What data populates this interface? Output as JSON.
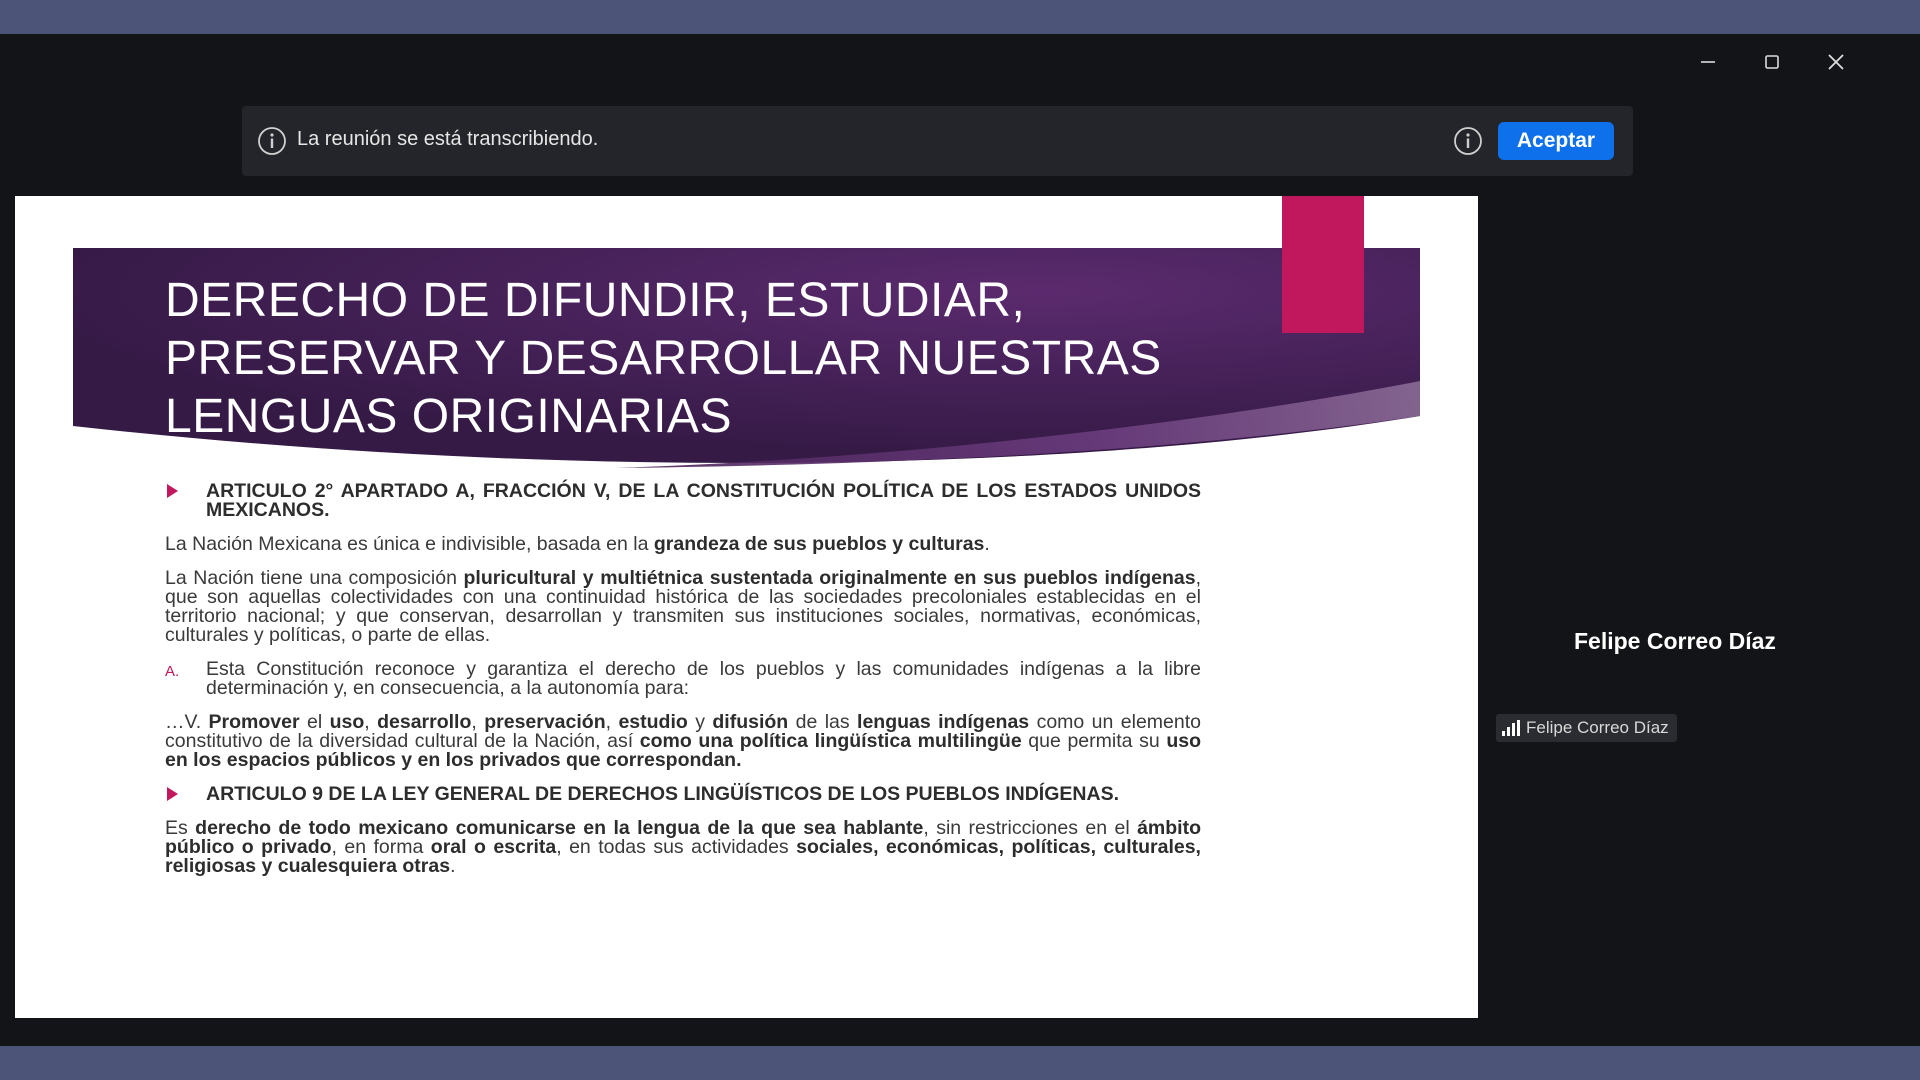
{
  "window": {
    "controls": {
      "minimize": "minimize-icon",
      "maximize": "maximize-icon",
      "close": "close-icon"
    }
  },
  "notice": {
    "text": "La reunión se está transcribiendo.",
    "accept_label": "Aceptar",
    "icon": "info-icon"
  },
  "slide": {
    "title_lines": [
      "DERECHO DE DIFUNDIR, ESTUDIAR,",
      "PRESERVAR Y DESARROLLAR NUESTRAS",
      "LENGUAS ORIGINARIAS"
    ],
    "bullet1": "ARTICULO 2° APARTADO A, FRACCIÓN V, DE LA CONSTITUCIÓN POLÍTICA DE LOS ESTADOS UNIDOS MEXICANOS.",
    "p1": {
      "t1": "La Nación Mexicana es única e indivisible, basada en la ",
      "b1": "grandeza de sus pueblos y culturas",
      "t2": "."
    },
    "p2": {
      "t1": "La Nación tiene una composición ",
      "b1": "pluricultural y multiétnica sustentada originalmente en sus pueblos indígenas",
      "t2": ", que son aquellas colectividades con una continuidad histórica de las sociedades precoloniales establecidas en el territorio nacional; y que conservan, desarrollan y transmiten sus instituciones sociales, normativas, económicas, culturales y políticas, o parte de ellas."
    },
    "item_a": {
      "letter": "A.",
      "text": "Esta Constitución reconoce y garantiza el derecho de los pueblos y las comunidades indígenas a la libre determinación y, en consecuencia, a la autonomía para:"
    },
    "p3": {
      "t1": "…V. ",
      "b1": "Promover",
      "t2": " el ",
      "b2": "uso",
      "t3": ", ",
      "b3": "desarrollo",
      "t4": ", ",
      "b4": "preservación",
      "t5": ", ",
      "b5": "estudio",
      "t6": " y ",
      "b6": "difusión",
      "t7": " de las ",
      "b7": "lenguas indígenas",
      "t8": " como un elemento constitutivo de la diversidad cultural de la Nación, así ",
      "b8": "como una política lingüística multilingüe",
      "t9": " que permita su ",
      "b9": "uso en los espacios públicos y en los privados que correspondan."
    },
    "bullet2": "ARTICULO 9 DE LA LEY GENERAL DE DERECHOS LINGÜÍSTICOS DE LOS PUEBLOS INDÍGENAS.",
    "p4": {
      "t1": "Es ",
      "b1": "derecho de todo mexicano comunicarse en la lengua de la que sea hablante",
      "t2": ", sin restricciones en el ",
      "b2": "ámbito público o privado",
      "t3": ", en forma ",
      "b3": "oral o escrita",
      "t4": ", en todas sus actividades ",
      "b4": "sociales, económicas, políticas, culturales, religiosas y cualesquiera otras",
      "t5": "."
    },
    "colors": {
      "banner_dark": "#3b1e4a",
      "banner_mid": "#5a2767",
      "accent": "#c0175d"
    }
  },
  "participant": {
    "name": "Felipe Correo Díaz",
    "tag_name": "Felipe Correo Díaz"
  }
}
